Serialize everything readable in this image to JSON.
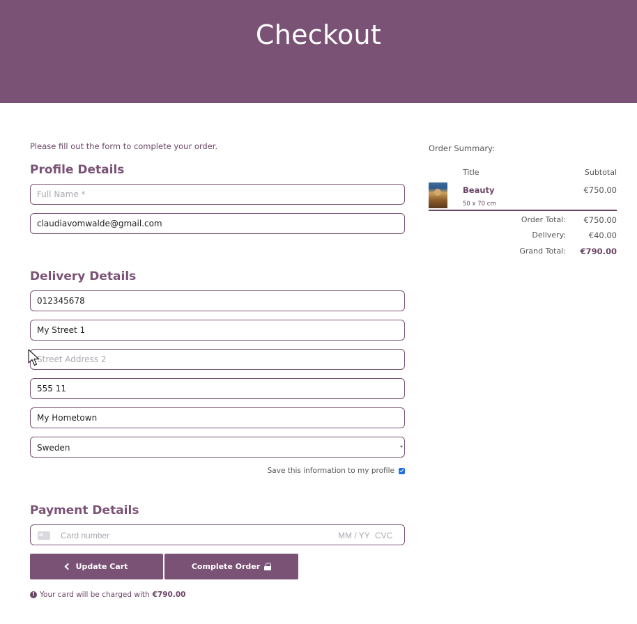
{
  "header": {
    "title": "Checkout"
  },
  "intro_text": "Please fill out the form to complete your order.",
  "profile": {
    "title": "Profile Details",
    "full_name": {
      "value": "",
      "placeholder": "Full Name *"
    },
    "email": {
      "value": "claudiavomwalde@gmail.com",
      "placeholder": ""
    }
  },
  "delivery": {
    "title": "Delivery Details",
    "phone": {
      "value": "012345678"
    },
    "street1": {
      "value": "My Street 1"
    },
    "street2": {
      "value": "",
      "placeholder": "Street Address 2"
    },
    "postcode": {
      "value": "555 11"
    },
    "town": {
      "value": "My Hometown"
    },
    "country": {
      "selected": "Sweden"
    },
    "save_label": "Save this information to my profile",
    "save_checked": true
  },
  "payment": {
    "title": "Payment Details",
    "card_number_placeholder": "Card number",
    "expiry_placeholder": "MM / YY",
    "cvc_placeholder": "CVC"
  },
  "buttons": {
    "update_cart": "Update Cart",
    "complete_order": "Complete Order"
  },
  "charge_note": {
    "text": "Your card will be charged with",
    "amount": "€790.00"
  },
  "summary": {
    "title": "Order Summary:",
    "col_title": "Title",
    "col_subtotal": "Subtotal",
    "items": [
      {
        "name": "Beauty",
        "size": "50 x 70 cm",
        "price": "€750.00"
      }
    ],
    "order_total_label": "Order Total:",
    "order_total": "€750.00",
    "delivery_label": "Delivery:",
    "delivery": "€40.00",
    "grand_total_label": "Grand Total:",
    "grand_total": "€790.00"
  },
  "colors": {
    "brand": "#7a5275",
    "text_accent": "#6b4666",
    "checkbox": "#1e6ee6"
  }
}
